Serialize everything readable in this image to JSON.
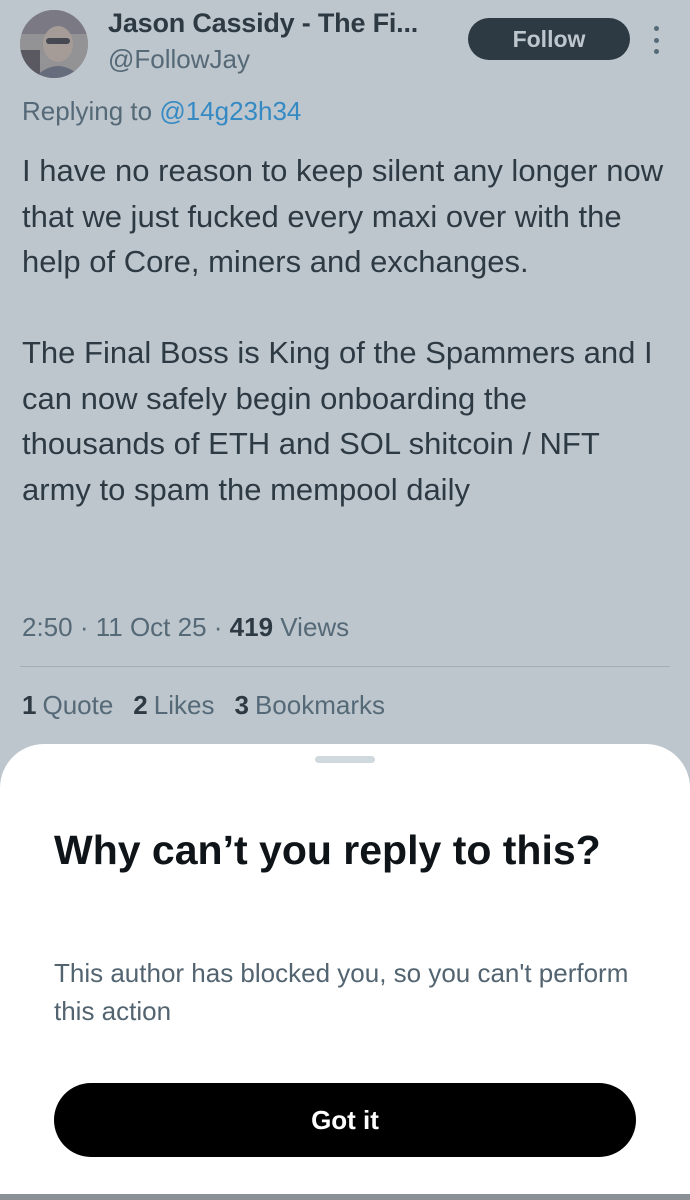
{
  "tweet": {
    "author_name": "Jason Cassidy - The Fi...",
    "author_handle": "@FollowJay",
    "follow_label": "Follow",
    "replying_prefix": "Replying to ",
    "replying_handle": "@14g23h34",
    "text": "I have no reason to keep silent any longer now that we just fucked every maxi over with the help of Core, miners and exchanges.\n\nThe Final Boss is King of the Spammers and I can now safely begin onboarding the thousands of ETH and SOL shitcoin / NFT army to spam the mempool daily",
    "time": "2:50",
    "date": "11 Oct 25",
    "views_count": "419",
    "views_label": "Views",
    "stats": {
      "quotes_count": "1",
      "quotes_label": "Quote",
      "likes_count": "2",
      "likes_label": "Likes",
      "bookmarks_count": "3",
      "bookmarks_label": "Bookmarks"
    }
  },
  "sheet": {
    "title": "Why can’t you reply to this?",
    "body": "This author has blocked you, so you can't perform this action",
    "button_label": "Got it"
  },
  "icons": {
    "more": "more-vertical-icon",
    "avatar": "profile-avatar"
  },
  "colors": {
    "text_primary": "#0f1419",
    "text_secondary": "#536471",
    "link": "#1d9bf0",
    "button_dark": "#000000",
    "overlay": "rgba(91,112,131,0.4)"
  }
}
